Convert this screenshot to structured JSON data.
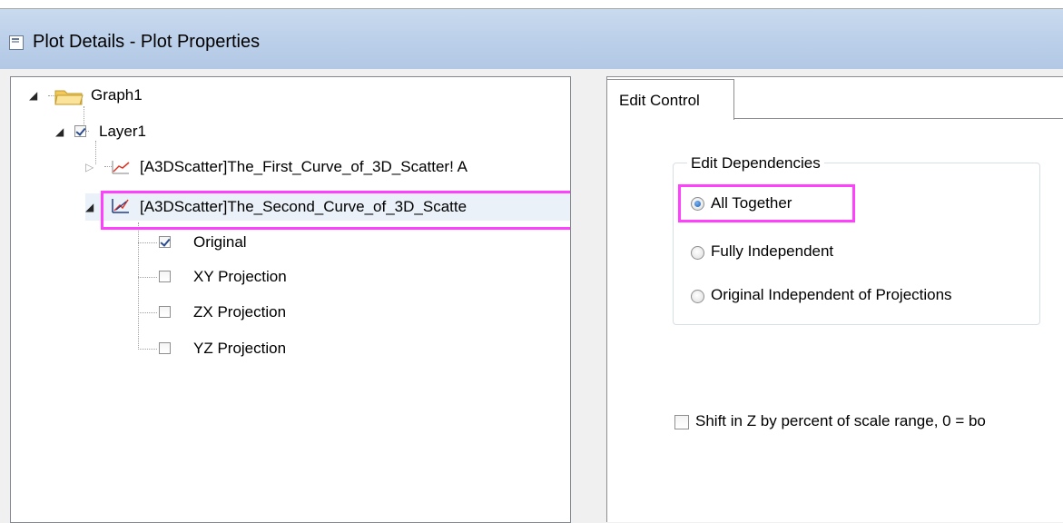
{
  "window": {
    "title": "Plot Details - Plot Properties"
  },
  "tree": {
    "root": {
      "label": "Graph1"
    },
    "layer": {
      "label": "Layer1"
    },
    "curve1": {
      "label": "[A3DScatter]The_First_Curve_of_3D_Scatter! A"
    },
    "curve2": {
      "label": "[A3DScatter]The_Second_Curve_of_3D_Scatte"
    },
    "children": [
      {
        "label": "Original",
        "checked": true
      },
      {
        "label": "XY Projection",
        "checked": false
      },
      {
        "label": "ZX Projection",
        "checked": false
      },
      {
        "label": "YZ Projection",
        "checked": false
      }
    ]
  },
  "tabs": [
    {
      "label": "Edit Control"
    }
  ],
  "edit_dependencies": {
    "label": "Edit Dependencies",
    "options": [
      {
        "label": "All Together",
        "selected": true
      },
      {
        "label": "Fully Independent",
        "selected": false
      },
      {
        "label": "Original Independent of Projections",
        "selected": false
      }
    ]
  },
  "shift_z": {
    "label": "Shift in Z by percent of scale range, 0 = bo",
    "checked": false
  },
  "colors": {
    "highlight": "#ff40ff",
    "titlebar": "#bcd0ea",
    "folder": "#f2c85a"
  }
}
